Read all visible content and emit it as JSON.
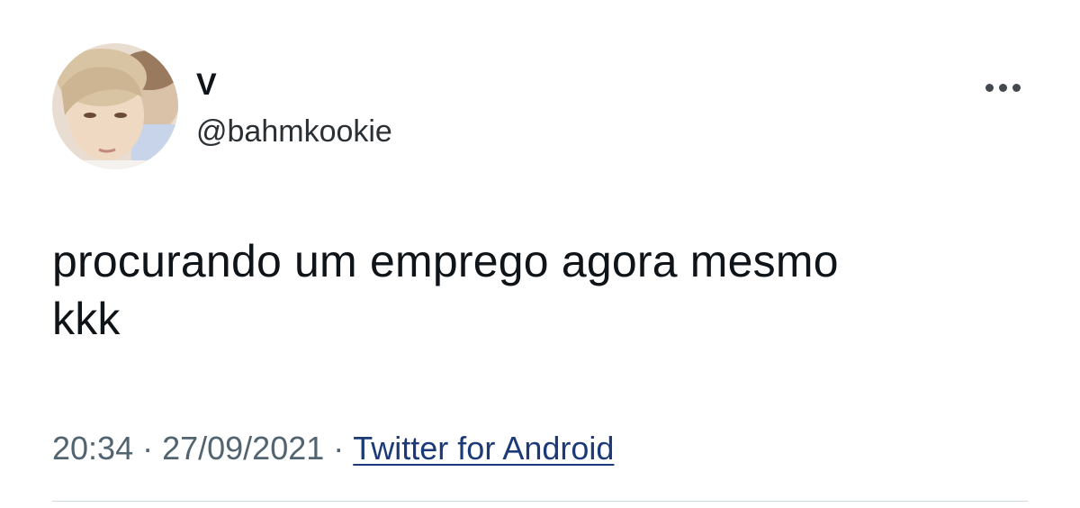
{
  "author": {
    "display_name": "V",
    "handle": "@bahmkookie"
  },
  "more_menu": {
    "icon": "more-horizontal-icon"
  },
  "tweet": {
    "lines": [
      "procurando um emprego agora mesmo",
      "kkk"
    ]
  },
  "meta": {
    "time": "20:34",
    "separator": "·",
    "date": "27/09/2021",
    "source": "Twitter for Android"
  },
  "colors": {
    "text_primary": "#0f1419",
    "text_secondary": "#536471",
    "source_link": "#1d3a78",
    "divider": "#cfd9de"
  }
}
